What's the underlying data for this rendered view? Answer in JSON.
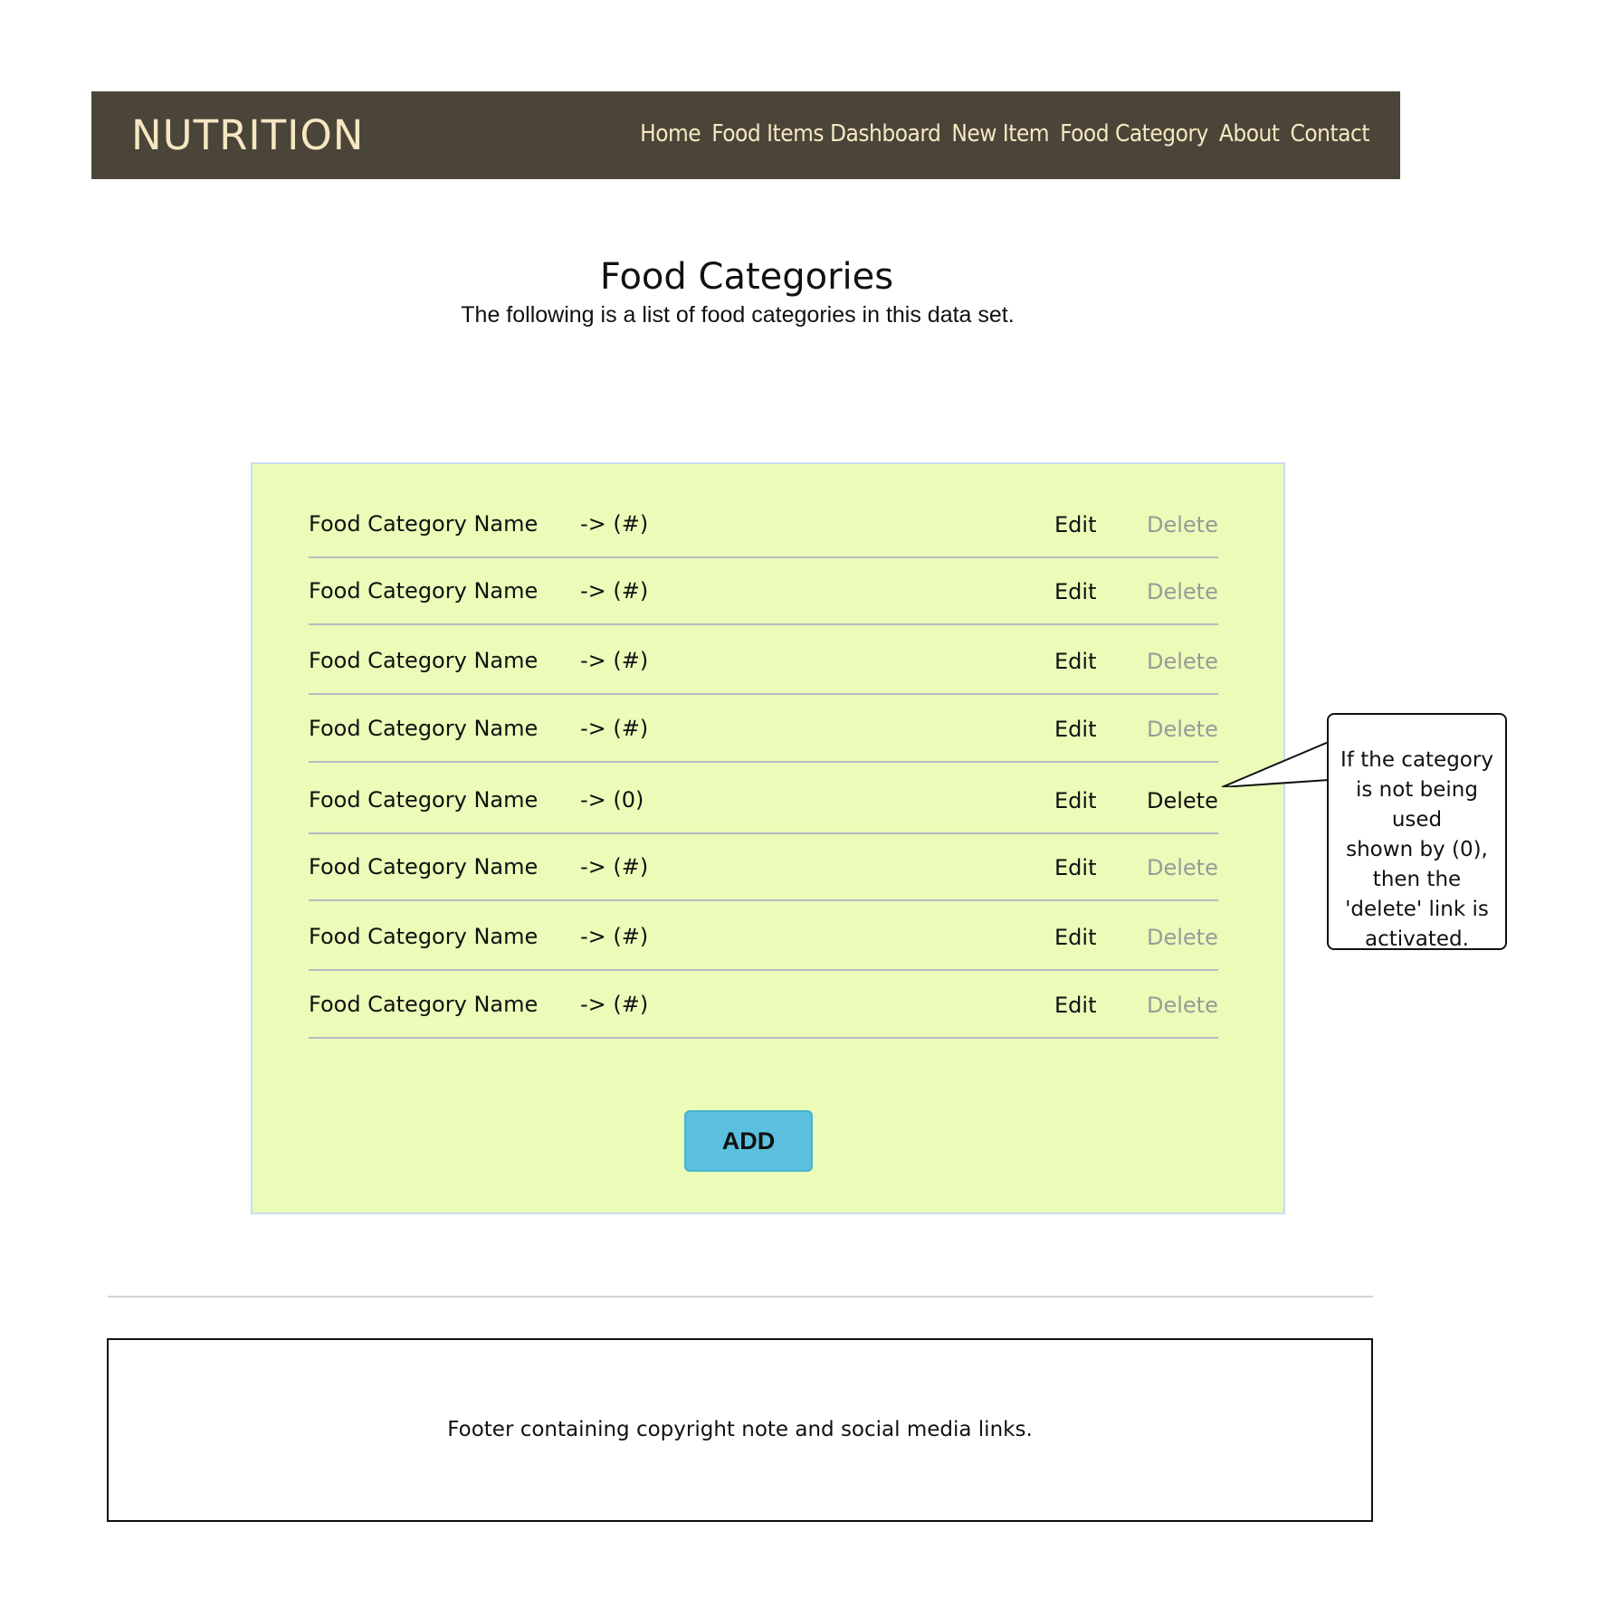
{
  "header": {
    "brand": "NUTRITION",
    "nav": [
      {
        "label": "Home"
      },
      {
        "label": "Food Items Dashboard"
      },
      {
        "label": "New Item"
      },
      {
        "label": "Food Category"
      },
      {
        "label": "About"
      },
      {
        "label": "Contact"
      }
    ]
  },
  "main": {
    "title": "Food Categories",
    "subtitle": "The following is a list of food categories in this data set."
  },
  "categories": [
    {
      "name": "Food Category Name",
      "count": "-> (#)",
      "edit": "Edit",
      "delete": "Delete",
      "delete_active": false
    },
    {
      "name": "Food Category Name",
      "count": "-> (#)",
      "edit": "Edit",
      "delete": "Delete",
      "delete_active": false
    },
    {
      "name": "Food Category Name",
      "count": "-> (#)",
      "edit": "Edit",
      "delete": "Delete",
      "delete_active": false
    },
    {
      "name": "Food Category Name",
      "count": "-> (#)",
      "edit": "Edit",
      "delete": "Delete",
      "delete_active": false
    },
    {
      "name": "Food Category Name",
      "count": "-> (0)",
      "edit": "Edit",
      "delete": "Delete",
      "delete_active": true
    },
    {
      "name": "Food Category Name",
      "count": "-> (#)",
      "edit": "Edit",
      "delete": "Delete",
      "delete_active": false
    },
    {
      "name": "Food Category Name",
      "count": "-> (#)",
      "edit": "Edit",
      "delete": "Delete",
      "delete_active": false
    },
    {
      "name": "Food Category Name",
      "count": "-> (#)",
      "edit": "Edit",
      "delete": "Delete",
      "delete_active": false
    }
  ],
  "add_button": "ADD",
  "callout": [
    "If the category",
    "is not being used",
    "shown by (0),",
    "then the",
    "'delete' link is",
    "activated."
  ],
  "footer": {
    "text": "Footer containing copyright note and social media links."
  },
  "colors": {
    "navbar_bg": "#4a4538",
    "nav_text": "#f6e7c2",
    "panel_bg": "#ebfbb8",
    "add_button_bg": "#5bc0de",
    "inactive_delete": "#9a9a9a"
  }
}
